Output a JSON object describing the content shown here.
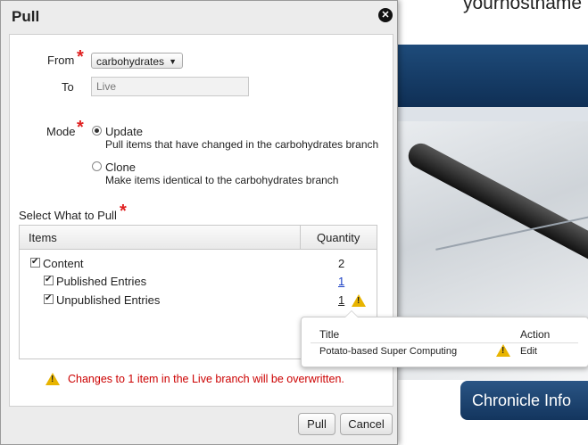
{
  "background": {
    "hostname": "yourhostname",
    "chronicle_button": "Chronicle Info"
  },
  "dialog": {
    "title": "Pull",
    "from_label": "From",
    "from_value": "carbohydrates",
    "to_label": "To",
    "to_value": "Live",
    "mode_label": "Mode",
    "modes": [
      {
        "label": "Update",
        "description": "Pull items that have changed in the carbohydrates branch",
        "selected": true
      },
      {
        "label": "Clone",
        "description": "Make items identical to the carbohydrates branch",
        "selected": false
      }
    ],
    "select_label": "Select What to Pull",
    "required_mark": "*",
    "grid": {
      "col_items": "Items",
      "col_quantity": "Quantity",
      "rows": [
        {
          "label": "Content",
          "quantity": "2",
          "checked": true
        },
        {
          "label": "Published Entries",
          "quantity": "1",
          "checked": true
        },
        {
          "label": "Unpublished Entries",
          "quantity": "1",
          "checked": true,
          "warning": true
        }
      ]
    },
    "warning_message": "Changes to 1 item in the Live branch will be overwritten.",
    "pull_button": "Pull",
    "cancel_button": "Cancel"
  },
  "popup": {
    "col_title": "Title",
    "col_action": "Action",
    "row_title": "Potato-based Super Computing",
    "row_action": "Edit"
  },
  "colors": {
    "required": "#e02020",
    "warning_text": "#cc0000",
    "warning_icon": "#e8b400",
    "link": "#1a3fc4"
  }
}
